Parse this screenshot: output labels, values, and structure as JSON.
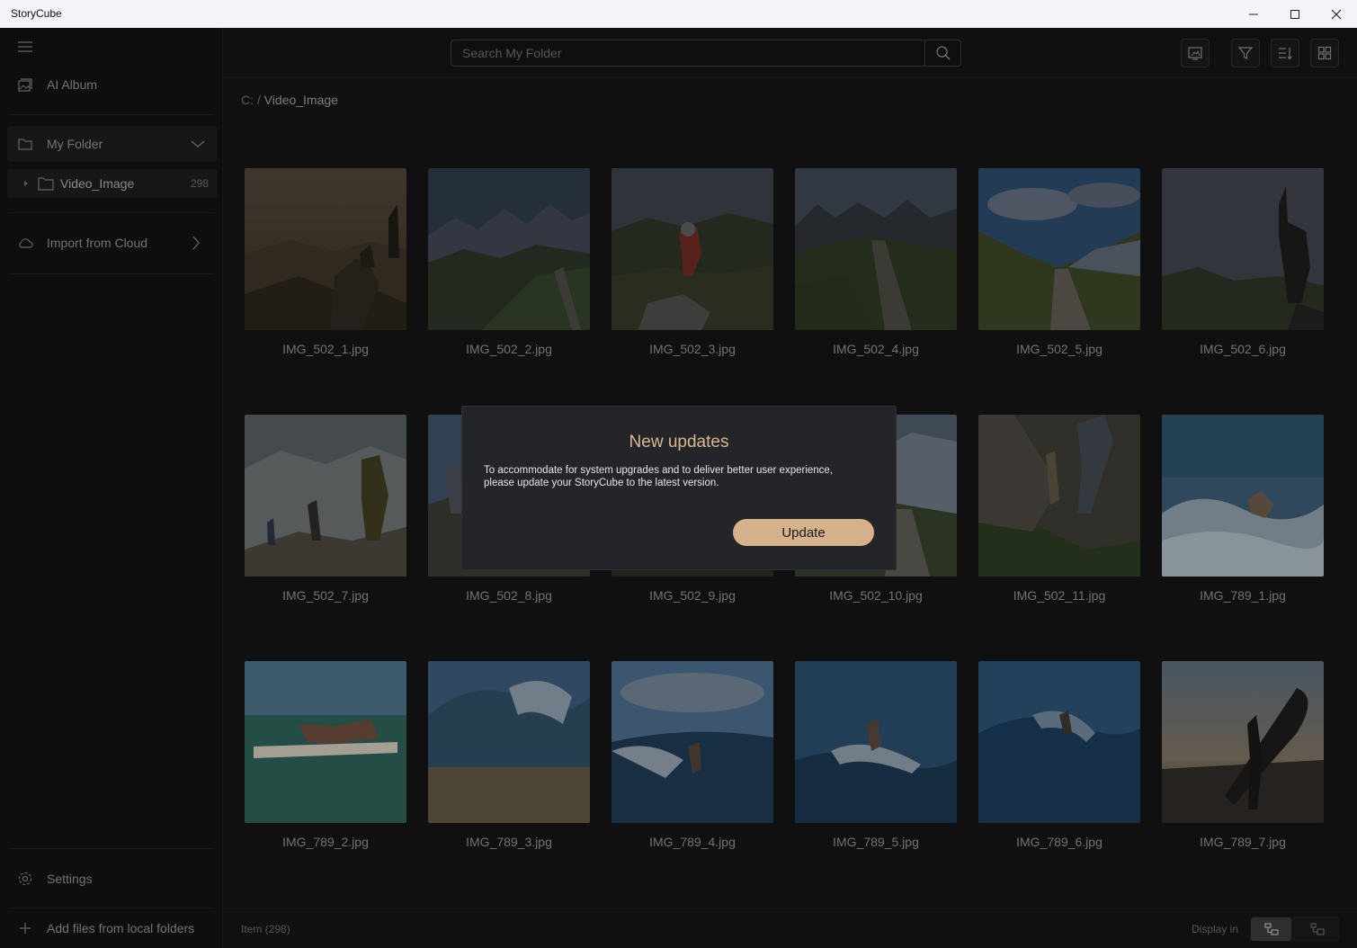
{
  "window": {
    "title": "StoryCube",
    "controls": [
      "minimize-icon",
      "maximize-icon",
      "close-icon"
    ]
  },
  "sidebar": {
    "ai_album": "AI Album",
    "my_folder": "My Folder",
    "folder": {
      "name": "Video_Image",
      "count": "298"
    },
    "import_cloud": "Import from Cloud",
    "settings": "Settings",
    "add_files": "Add files from local folders"
  },
  "toolbar": {
    "search_placeholder": "Search My Folder"
  },
  "breadcrumb": {
    "root": "C:",
    "separator": "/",
    "current": "Video_Image"
  },
  "grid": {
    "items": [
      "IMG_502_1.jpg",
      "IMG_502_2.jpg",
      "IMG_502_3.jpg",
      "IMG_502_4.jpg",
      "IMG_502_5.jpg",
      "IMG_502_6.jpg",
      "IMG_502_7.jpg",
      "IMG_502_8.jpg",
      "IMG_502_9.jpg",
      "IMG_502_10.jpg",
      "IMG_502_11.jpg",
      "IMG_789_1.jpg",
      "IMG_789_2.jpg",
      "IMG_789_3.jpg",
      "IMG_789_4.jpg",
      "IMG_789_5.jpg",
      "IMG_789_6.jpg",
      "IMG_789_7.jpg"
    ]
  },
  "footer": {
    "item_count": "Item (298)",
    "display_in": "Display in"
  },
  "dialog": {
    "title": "New updates",
    "body": "To accommodate for system upgrades and to deliver better user experience, please update your StoryCube to the latest version.",
    "button": "Update"
  },
  "colors": {
    "accent": "#d5b28c",
    "dialog_title": "#d9b891",
    "background": "#141415"
  }
}
